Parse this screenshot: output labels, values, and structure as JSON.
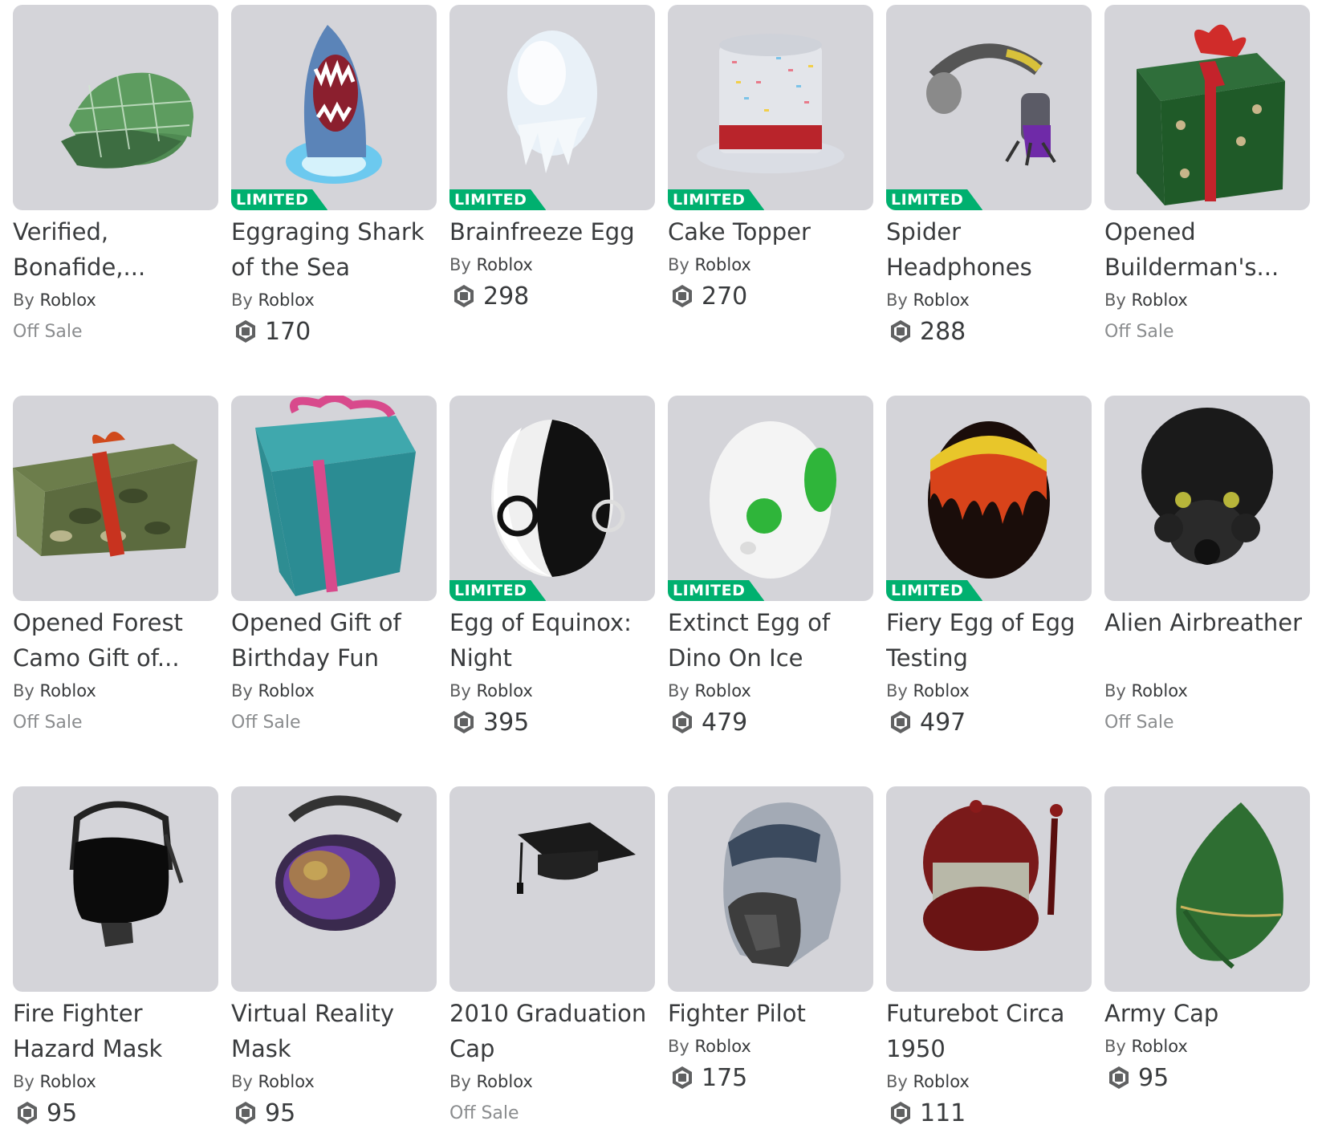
{
  "badge_label": "LIMITED",
  "by_label": "By",
  "colors": {
    "thumbnail_bg": "#d4d4d9",
    "limited_badge": "#00b06f",
    "text": "#393b3d",
    "muted": "#8a8c8e"
  },
  "items": [
    {
      "name": "Verified, Bonafide,...",
      "creator": "Roblox",
      "limited": false,
      "price": "Off Sale",
      "off_sale": true,
      "icon": "green-plaid-cap-icon"
    },
    {
      "name": "Eggraging Shark of the Sea",
      "creator": "Roblox",
      "limited": true,
      "price": "170",
      "off_sale": false,
      "icon": "shark-egg-icon"
    },
    {
      "name": "Brainfreeze Egg",
      "creator": "Roblox",
      "limited": true,
      "price": "298",
      "off_sale": false,
      "icon": "ice-egg-icon"
    },
    {
      "name": "Cake Topper",
      "creator": "Roblox",
      "limited": true,
      "price": "270",
      "off_sale": false,
      "icon": "cake-top-hat-icon"
    },
    {
      "name": "Spider Headphones",
      "creator": "Roblox",
      "limited": true,
      "price": "288",
      "off_sale": false,
      "icon": "spider-headphones-icon"
    },
    {
      "name": "Opened Builderman's...",
      "creator": "Roblox",
      "limited": false,
      "price": "Off Sale",
      "off_sale": true,
      "icon": "gift-box-icon"
    },
    {
      "name": "Opened Forest Camo Gift of...",
      "creator": "Roblox",
      "limited": false,
      "price": "Off Sale",
      "off_sale": true,
      "icon": "camo-gift-icon"
    },
    {
      "name": "Opened Gift of Birthday Fun",
      "creator": "Roblox",
      "limited": false,
      "price": "Off Sale",
      "off_sale": true,
      "icon": "teal-gift-icon"
    },
    {
      "name": "Egg of Equinox: Night",
      "creator": "Roblox",
      "limited": true,
      "price": "395",
      "off_sale": false,
      "icon": "black-white-egg-icon"
    },
    {
      "name": "Extinct Egg of Dino On Ice",
      "creator": "Roblox",
      "limited": true,
      "price": "479",
      "off_sale": false,
      "icon": "dino-egg-icon"
    },
    {
      "name": "Fiery Egg of Egg Testing",
      "creator": "Roblox",
      "limited": true,
      "price": "497",
      "off_sale": false,
      "icon": "fiery-egg-icon"
    },
    {
      "name": "Alien Airbreather",
      "creator": "Roblox",
      "limited": false,
      "price": "Off Sale",
      "off_sale": true,
      "icon": "alien-airbreather-icon"
    },
    {
      "name": "Fire Fighter Hazard Mask",
      "creator": "Roblox",
      "limited": false,
      "price": "95",
      "off_sale": false,
      "icon": "hazard-mask-icon"
    },
    {
      "name": "Virtual Reality Mask",
      "creator": "Roblox",
      "limited": false,
      "price": "95",
      "off_sale": false,
      "icon": "vr-mask-icon"
    },
    {
      "name": "2010 Graduation Cap",
      "creator": "Roblox",
      "limited": false,
      "price": "Off Sale",
      "off_sale": true,
      "icon": "graduation-cap-icon"
    },
    {
      "name": "Fighter Pilot",
      "creator": "Roblox",
      "limited": false,
      "price": "175",
      "off_sale": false,
      "icon": "pilot-helmet-icon"
    },
    {
      "name": "Futurebot Circa 1950",
      "creator": "Roblox",
      "limited": false,
      "price": "111",
      "off_sale": false,
      "icon": "futurebot-helmet-icon"
    },
    {
      "name": "Army Cap",
      "creator": "Roblox",
      "limited": false,
      "price": "95",
      "off_sale": false,
      "icon": "army-cap-icon"
    }
  ]
}
